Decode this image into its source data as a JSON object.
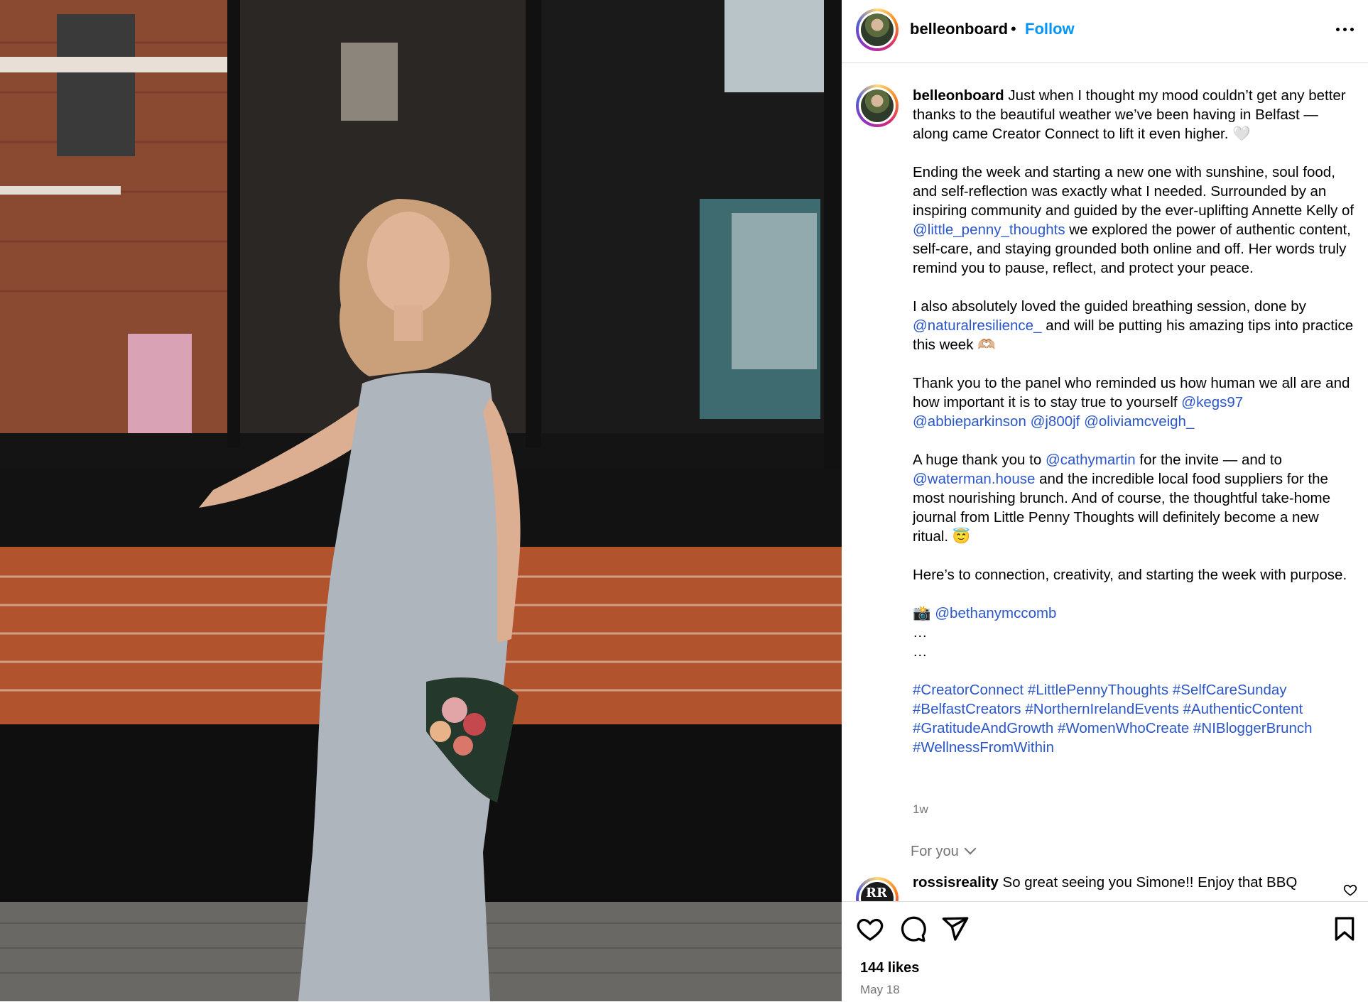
{
  "post": {
    "username": "belleonboard",
    "dot": "•",
    "follow_label": "Follow"
  },
  "caption": {
    "username": "belleonboard",
    "p1": "Just when I thought my mood couldn’t get any better thanks to the beautiful weather we’ve been having in Belfast — along came Creator Connect to lift it even higher. 🤍",
    "p2_a": "Ending the week and starting a new one with sunshine, soul food, and self-reflection was exactly what I needed. Surrounded by an inspiring community and guided by the ever-uplifting Annette Kelly of ",
    "p2_mention": "@little_penny_thoughts",
    "p2_b": " we explored the power of authentic content, self-care, and staying grounded both online and off. Her words truly remind you to pause, reflect, and protect your peace.",
    "p3_a": "I also absolutely loved the guided breathing session, done by ",
    "p3_mention": "@naturalresilience_",
    "p3_b": " and will be putting his amazing tips into practice this week 🫶🏼",
    "p4_a": "Thank you to the panel who reminded us how human we all are and how important it is to stay true to yourself ",
    "p4_m1": "@kegs97",
    "p4_m2": "@abbieparkinson",
    "p4_m3": "@j800jf",
    "p4_m4": "@oliviamcveigh_",
    "p5_a": "A huge thank you to ",
    "p5_m1": "@cathymartin",
    "p5_b": " for the invite — and to ",
    "p5_m2": "@waterman.house",
    "p5_c": " and the incredible local food suppliers for the most nourishing brunch. And of course, the thoughtful take-home journal from Little Penny Thoughts will definitely become a new ritual. 😇",
    "p6": "Here’s to connection, creativity, and starting the week with purpose.",
    "photo_credit_emoji": "📸",
    "photo_credit": "@bethanymccomb",
    "ellipsis1": "…",
    "ellipsis2": "…",
    "hashtags": [
      "#CreatorConnect",
      "#LittlePennyThoughts",
      "#SelfCareSunday",
      "#BelfastCreators",
      "#NorthernIrelandEvents",
      "#AuthenticContent",
      "#GratitudeAndGrowth",
      "#WomenWhoCreate",
      "#NIBloggerBrunch",
      "#WellnessFromWithin"
    ],
    "time_ago": "1w"
  },
  "comments": {
    "sort_label": "For you",
    "first": {
      "avatar_text": "RR",
      "username": "rossisreality",
      "text": "So great seeing you Simone!! Enjoy that BBQ"
    }
  },
  "actions": {
    "likes": "144 likes",
    "date": "May 18"
  },
  "icons": [
    "more-icon",
    "heart-icon",
    "comment-icon",
    "share-icon",
    "bookmark-icon"
  ],
  "colors": {
    "follow": "#0095f6",
    "link": "#2b57c7",
    "muted": "#737373",
    "divider": "#dbdbdb"
  }
}
